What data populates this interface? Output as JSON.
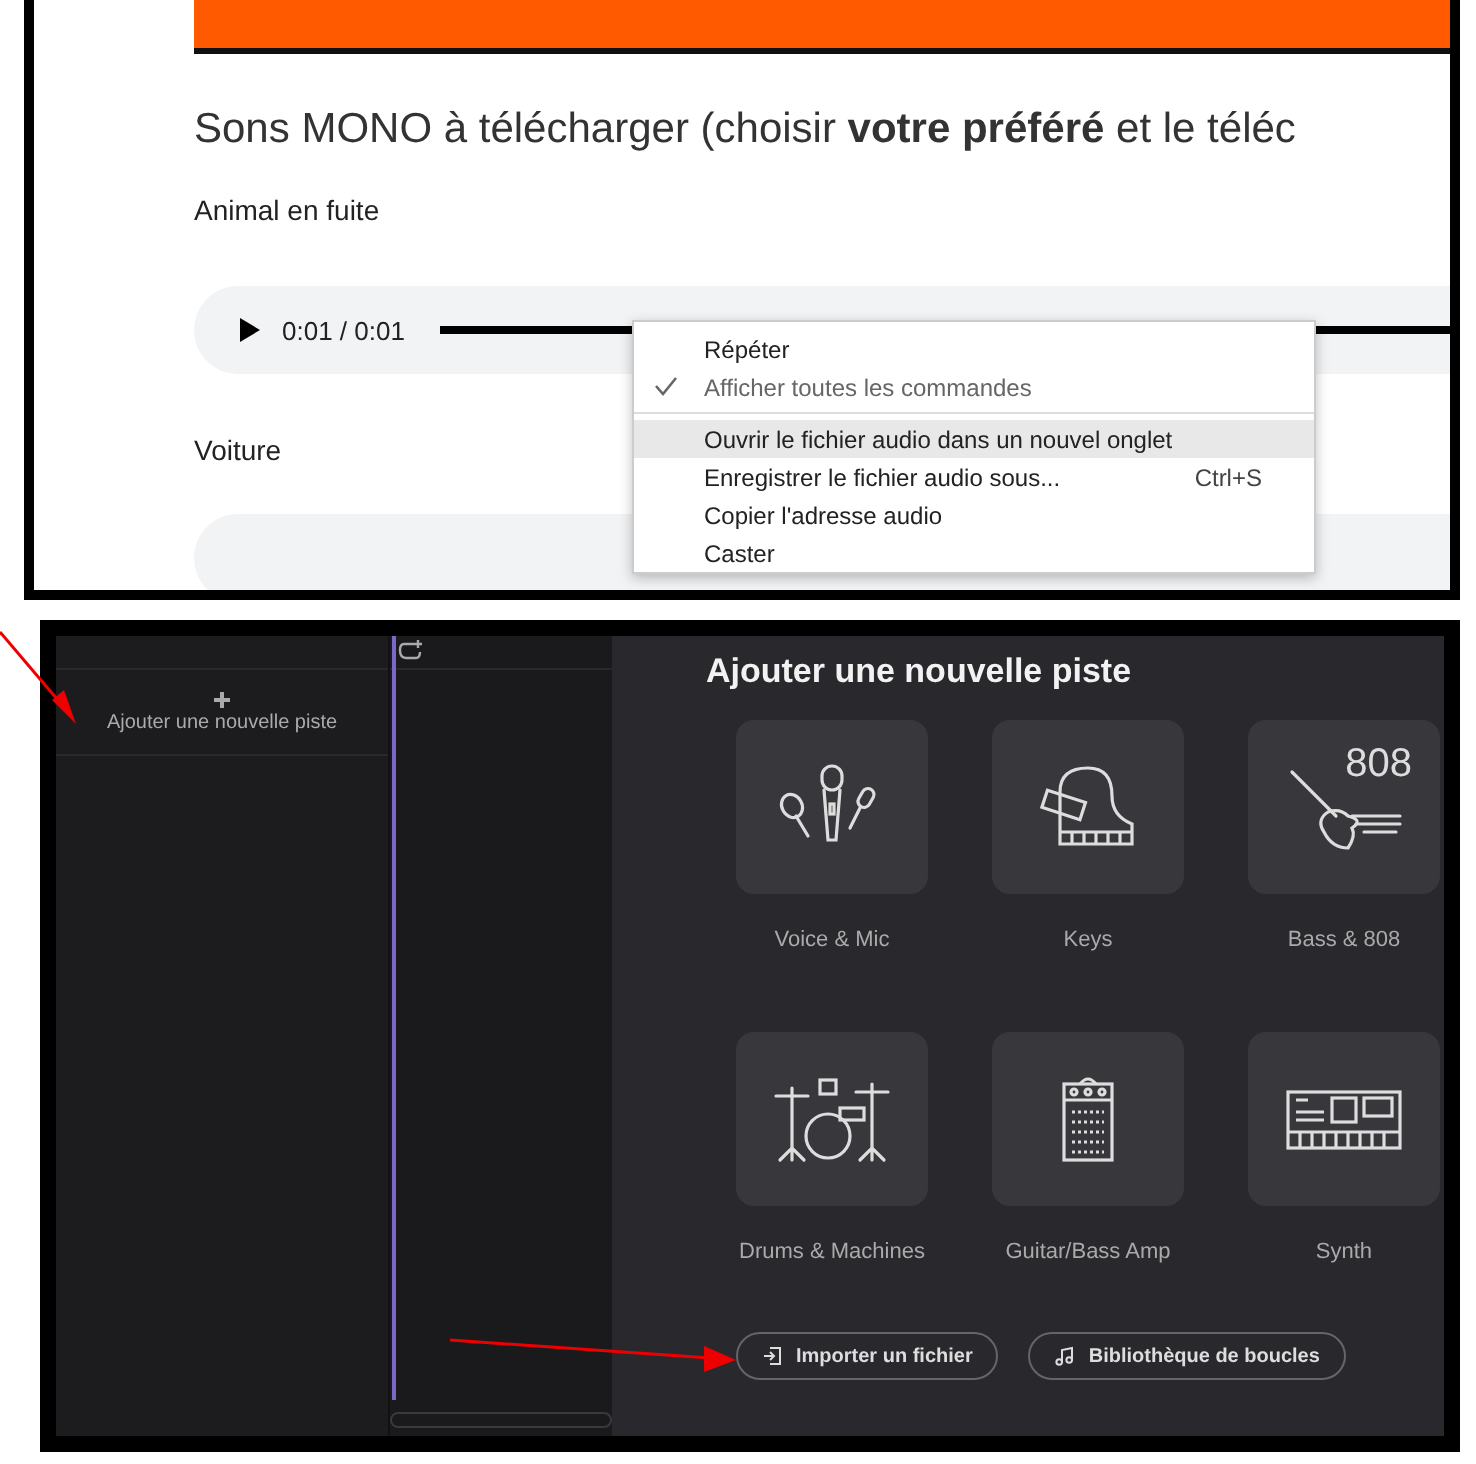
{
  "web_page": {
    "heading": "Sons MONO à télécharger (choisir **votre préféré** et le téléc",
    "sounds": [
      {
        "label": "Animal en fuite",
        "player": {
          "time": "0:01 / 0:01",
          "level": 1
        }
      },
      {
        "label": "Voiture"
      }
    ],
    "context_menu": {
      "groups": [
        [
          {
            "label": "Répéter",
            "checked": false,
            "selected": false
          },
          {
            "label": "Afficher toutes les commandes",
            "checked": true,
            "selected": false
          }
        ],
        [
          {
            "label": "Ouvrir le fichier audio dans un nouvel onglet",
            "checked": false,
            "selected": true
          },
          {
            "label": "Enregistrer le fichier audio sous...",
            "shortcut": "Ctrl+S",
            "checked": false,
            "selected": false
          },
          {
            "label": "Copier l'adresse audio",
            "checked": false,
            "selected": false
          },
          {
            "label": "Caster",
            "checked": false,
            "selected": false
          }
        ]
      ]
    }
  },
  "studio": {
    "track_list": {
      "add_track": "Ajouter une nouvelle piste"
    },
    "panel": {
      "title": "Ajouter une nouvelle piste",
      "instruments": [
        {
          "kind": "voice",
          "label": "Voice & Mic"
        },
        {
          "kind": "keys",
          "label": "Keys"
        },
        {
          "kind": "bass",
          "label": "Bass & 808",
          "icon_text": "808"
        },
        {
          "kind": "drums",
          "label": "Drums & Machines"
        },
        {
          "kind": "amp",
          "label": "Guitar/Bass Amp"
        },
        {
          "kind": "synth",
          "label": "Synth"
        }
      ],
      "buttons": [
        {
          "kind": "import",
          "label": "Importer un fichier"
        },
        {
          "kind": "loops",
          "label": "Bibliothèque de boucles"
        }
      ]
    }
  }
}
